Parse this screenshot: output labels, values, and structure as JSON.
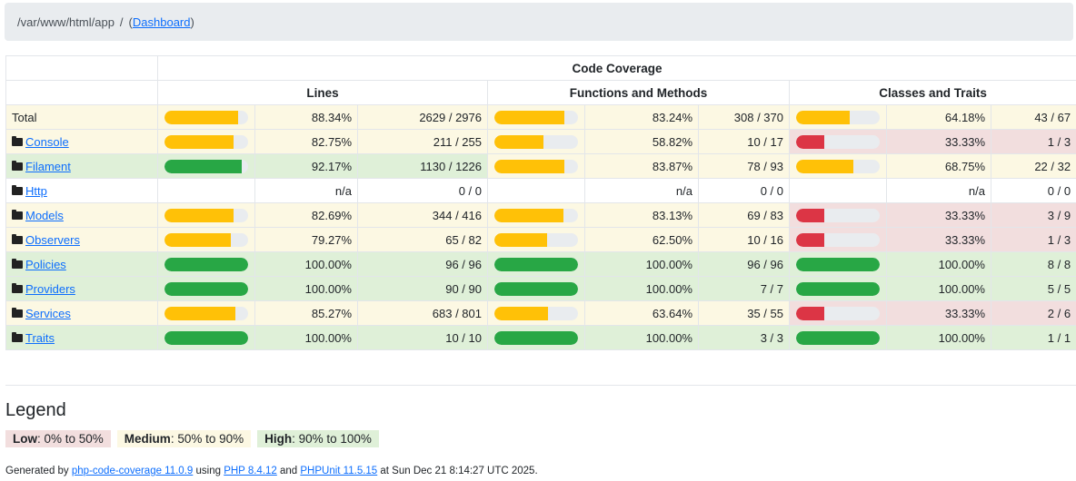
{
  "breadcrumb": {
    "path": "/var/www/html/app",
    "separator": "/",
    "open": "(",
    "link": "Dashboard",
    "close": ")"
  },
  "table": {
    "header_group": "Code Coverage",
    "columns": [
      "Lines",
      "Functions and Methods",
      "Classes and Traits"
    ],
    "rows": [
      {
        "name": "Total",
        "is_folder": false,
        "lines": {
          "pct": "88.34%",
          "count": "2629 / 2976",
          "value": 88.34,
          "level": "med"
        },
        "functions": {
          "pct": "83.24%",
          "count": "308 / 370",
          "value": 83.24,
          "level": "med"
        },
        "classes": {
          "pct": "64.18%",
          "count": "43 / 67",
          "value": 64.18,
          "level": "med"
        },
        "row_level": "warn"
      },
      {
        "name": "Console",
        "is_folder": true,
        "lines": {
          "pct": "82.75%",
          "count": "211 / 255",
          "value": 82.75,
          "level": "med"
        },
        "functions": {
          "pct": "58.82%",
          "count": "10 / 17",
          "value": 58.82,
          "level": "med"
        },
        "classes": {
          "pct": "33.33%",
          "count": "1 / 3",
          "value": 33.33,
          "level": "low"
        },
        "row_level": "warn"
      },
      {
        "name": "Filament",
        "is_folder": true,
        "lines": {
          "pct": "92.17%",
          "count": "1130 / 1226",
          "value": 92.17,
          "level": "high"
        },
        "functions": {
          "pct": "83.87%",
          "count": "78 / 93",
          "value": 83.87,
          "level": "med"
        },
        "classes": {
          "pct": "68.75%",
          "count": "22 / 32",
          "value": 68.75,
          "level": "med"
        },
        "row_level": "success"
      },
      {
        "name": "Http",
        "is_folder": true,
        "lines": {
          "pct": "n/a",
          "count": "0 / 0",
          "value": null,
          "level": "none"
        },
        "functions": {
          "pct": "n/a",
          "count": "0 / 0",
          "value": null,
          "level": "none"
        },
        "classes": {
          "pct": "n/a",
          "count": "0 / 0",
          "value": null,
          "level": "none"
        },
        "row_level": "none"
      },
      {
        "name": "Models",
        "is_folder": true,
        "lines": {
          "pct": "82.69%",
          "count": "344 / 416",
          "value": 82.69,
          "level": "med"
        },
        "functions": {
          "pct": "83.13%",
          "count": "69 / 83",
          "value": 83.13,
          "level": "med"
        },
        "classes": {
          "pct": "33.33%",
          "count": "3 / 9",
          "value": 33.33,
          "level": "low"
        },
        "row_level": "warn"
      },
      {
        "name": "Observers",
        "is_folder": true,
        "lines": {
          "pct": "79.27%",
          "count": "65 / 82",
          "value": 79.27,
          "level": "med"
        },
        "functions": {
          "pct": "62.50%",
          "count": "10 / 16",
          "value": 62.5,
          "level": "med"
        },
        "classes": {
          "pct": "33.33%",
          "count": "1 / 3",
          "value": 33.33,
          "level": "low"
        },
        "row_level": "warn"
      },
      {
        "name": "Policies",
        "is_folder": true,
        "lines": {
          "pct": "100.00%",
          "count": "96 / 96",
          "value": 100,
          "level": "high"
        },
        "functions": {
          "pct": "100.00%",
          "count": "96 / 96",
          "value": 100,
          "level": "high"
        },
        "classes": {
          "pct": "100.00%",
          "count": "8 / 8",
          "value": 100,
          "level": "high"
        },
        "row_level": "success"
      },
      {
        "name": "Providers",
        "is_folder": true,
        "lines": {
          "pct": "100.00%",
          "count": "90 / 90",
          "value": 100,
          "level": "high"
        },
        "functions": {
          "pct": "100.00%",
          "count": "7 / 7",
          "value": 100,
          "level": "high"
        },
        "classes": {
          "pct": "100.00%",
          "count": "5 / 5",
          "value": 100,
          "level": "high"
        },
        "row_level": "success"
      },
      {
        "name": "Services",
        "is_folder": true,
        "lines": {
          "pct": "85.27%",
          "count": "683 / 801",
          "value": 85.27,
          "level": "med"
        },
        "functions": {
          "pct": "63.64%",
          "count": "35 / 55",
          "value": 63.64,
          "level": "med"
        },
        "classes": {
          "pct": "33.33%",
          "count": "2 / 6",
          "value": 33.33,
          "level": "low"
        },
        "row_level": "warn"
      },
      {
        "name": "Traits",
        "is_folder": true,
        "lines": {
          "pct": "100.00%",
          "count": "10 / 10",
          "value": 100,
          "level": "high"
        },
        "functions": {
          "pct": "100.00%",
          "count": "3 / 3",
          "value": 100,
          "level": "high"
        },
        "classes": {
          "pct": "100.00%",
          "count": "1 / 1",
          "value": 100,
          "level": "high"
        },
        "row_level": "success"
      }
    ]
  },
  "legend": {
    "title": "Legend",
    "low_label": "Low",
    "low_range": ": 0% to 50%",
    "medium_label": "Medium",
    "medium_range": ": 50% to 90%",
    "high_label": "High",
    "high_range": ": 90% to 100%"
  },
  "footer": {
    "prefix": "Generated by ",
    "tool_link": "php-code-coverage 11.0.9",
    "using": " using ",
    "php_link": "PHP 8.4.12",
    "and": " and ",
    "phpunit_link": "PHPUnit 11.5.15",
    "suffix": " at Sun Dec 21 8:14:27 UTC 2025."
  },
  "colors": {
    "low": "#dc3545",
    "medium": "#ffc107",
    "high": "#28a745",
    "low_bg": "#f2dede",
    "medium_bg": "#fcf8e3",
    "high_bg": "#dff0d8"
  }
}
